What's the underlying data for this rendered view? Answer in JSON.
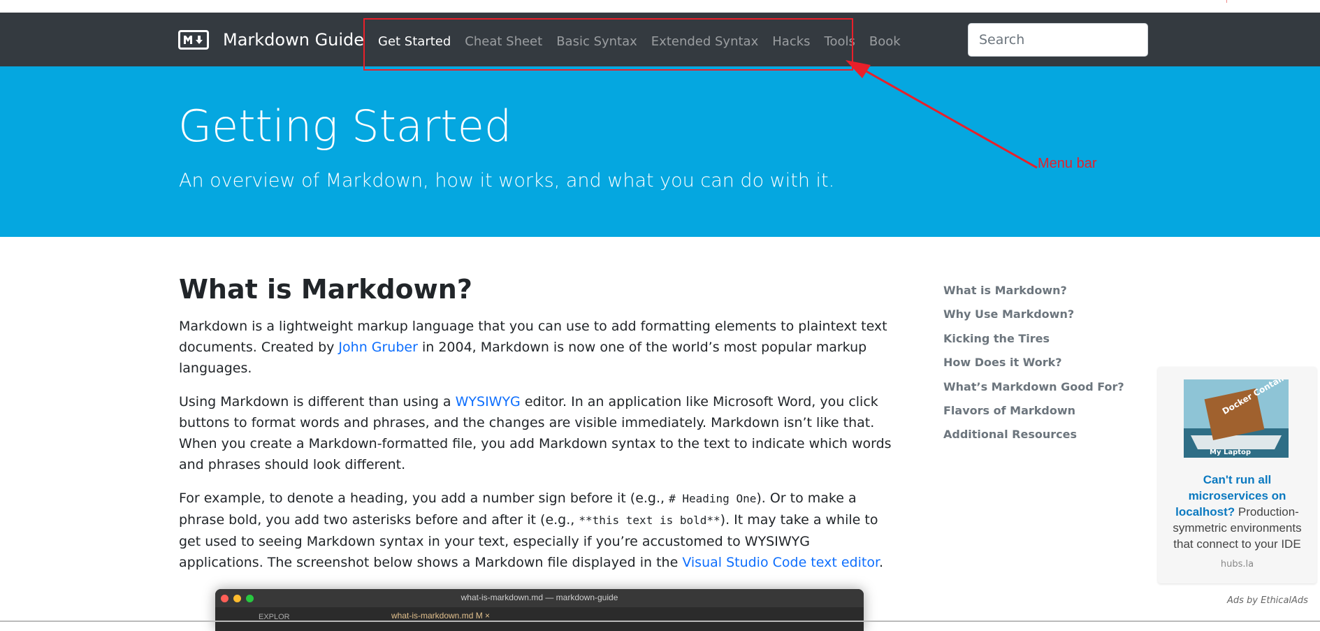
{
  "navbar": {
    "brand_name": "Markdown Guide",
    "search_placeholder": "Search",
    "links": [
      {
        "label": "Get Started",
        "active": true
      },
      {
        "label": "Cheat Sheet"
      },
      {
        "label": "Basic Syntax"
      },
      {
        "label": "Extended Syntax"
      },
      {
        "label": "Hacks"
      },
      {
        "label": "Tools"
      },
      {
        "label": "Book"
      }
    ]
  },
  "annotation": {
    "label": "Menu bar",
    "color": "#e8202a"
  },
  "hero": {
    "title": "Getting Started",
    "subtitle": "An overview of Markdown, how it works, and what you can do with it."
  },
  "main": {
    "heading": "What is Markdown?",
    "p1": {
      "a": "Markdown is a lightweight markup language that you can use to add formatting elements to plaintext text documents. Created by ",
      "link": "John Gruber",
      "b": " in 2004, Markdown is now one of the world’s most popular markup languages."
    },
    "p2": {
      "a": "Using Markdown is different than using a ",
      "link": "WYSIWYG",
      "b": " editor. In an application like Microsoft Word, you click buttons to format words and phrases, and the changes are visible immediately. Markdown isn’t like that. When you create a Markdown-formatted file, you add Markdown syntax to the text to indicate which words and phrases should look different."
    },
    "p3": {
      "a": "For example, to denote a heading, you add a number sign before it (e.g., ",
      "code1": "# Heading One",
      "b": "). Or to make a phrase bold, you add two asterisks before and after it (e.g., ",
      "code2": "**this text is bold**",
      "c": "). It may take a while to get used to seeing Markdown syntax in your text, especially if you’re accustomed to WYSIWYG applications. The screenshot below shows a Markdown file displayed in the ",
      "link": "Visual Studio Code text editor",
      "d": "."
    }
  },
  "toc": [
    "What is Markdown?",
    "Why Use Markdown?",
    "Kicking the Tires",
    "How Does it Work?",
    "What’s Markdown Good For?",
    "Flavors of Markdown",
    "Additional Resources"
  ],
  "ad": {
    "image_caption_1": "Docker Container",
    "image_caption_2": "My Laptop",
    "headline": "Can't run all microservices on localhost?",
    "body": " Production-symmetric environments that connect to your IDE",
    "domain": "hubs.la",
    "attribution": "Ads by EthicalAds"
  },
  "editor": {
    "window_title": "what-is-markdown.md — markdown-guide",
    "tab": "what-is-markdown.md  M  ×",
    "explorer": "EXPLOR"
  },
  "colors": {
    "navbar": "#343a40",
    "hero": "#05a7e0",
    "link": "#0d6efd",
    "annotation": "#e8202a"
  }
}
